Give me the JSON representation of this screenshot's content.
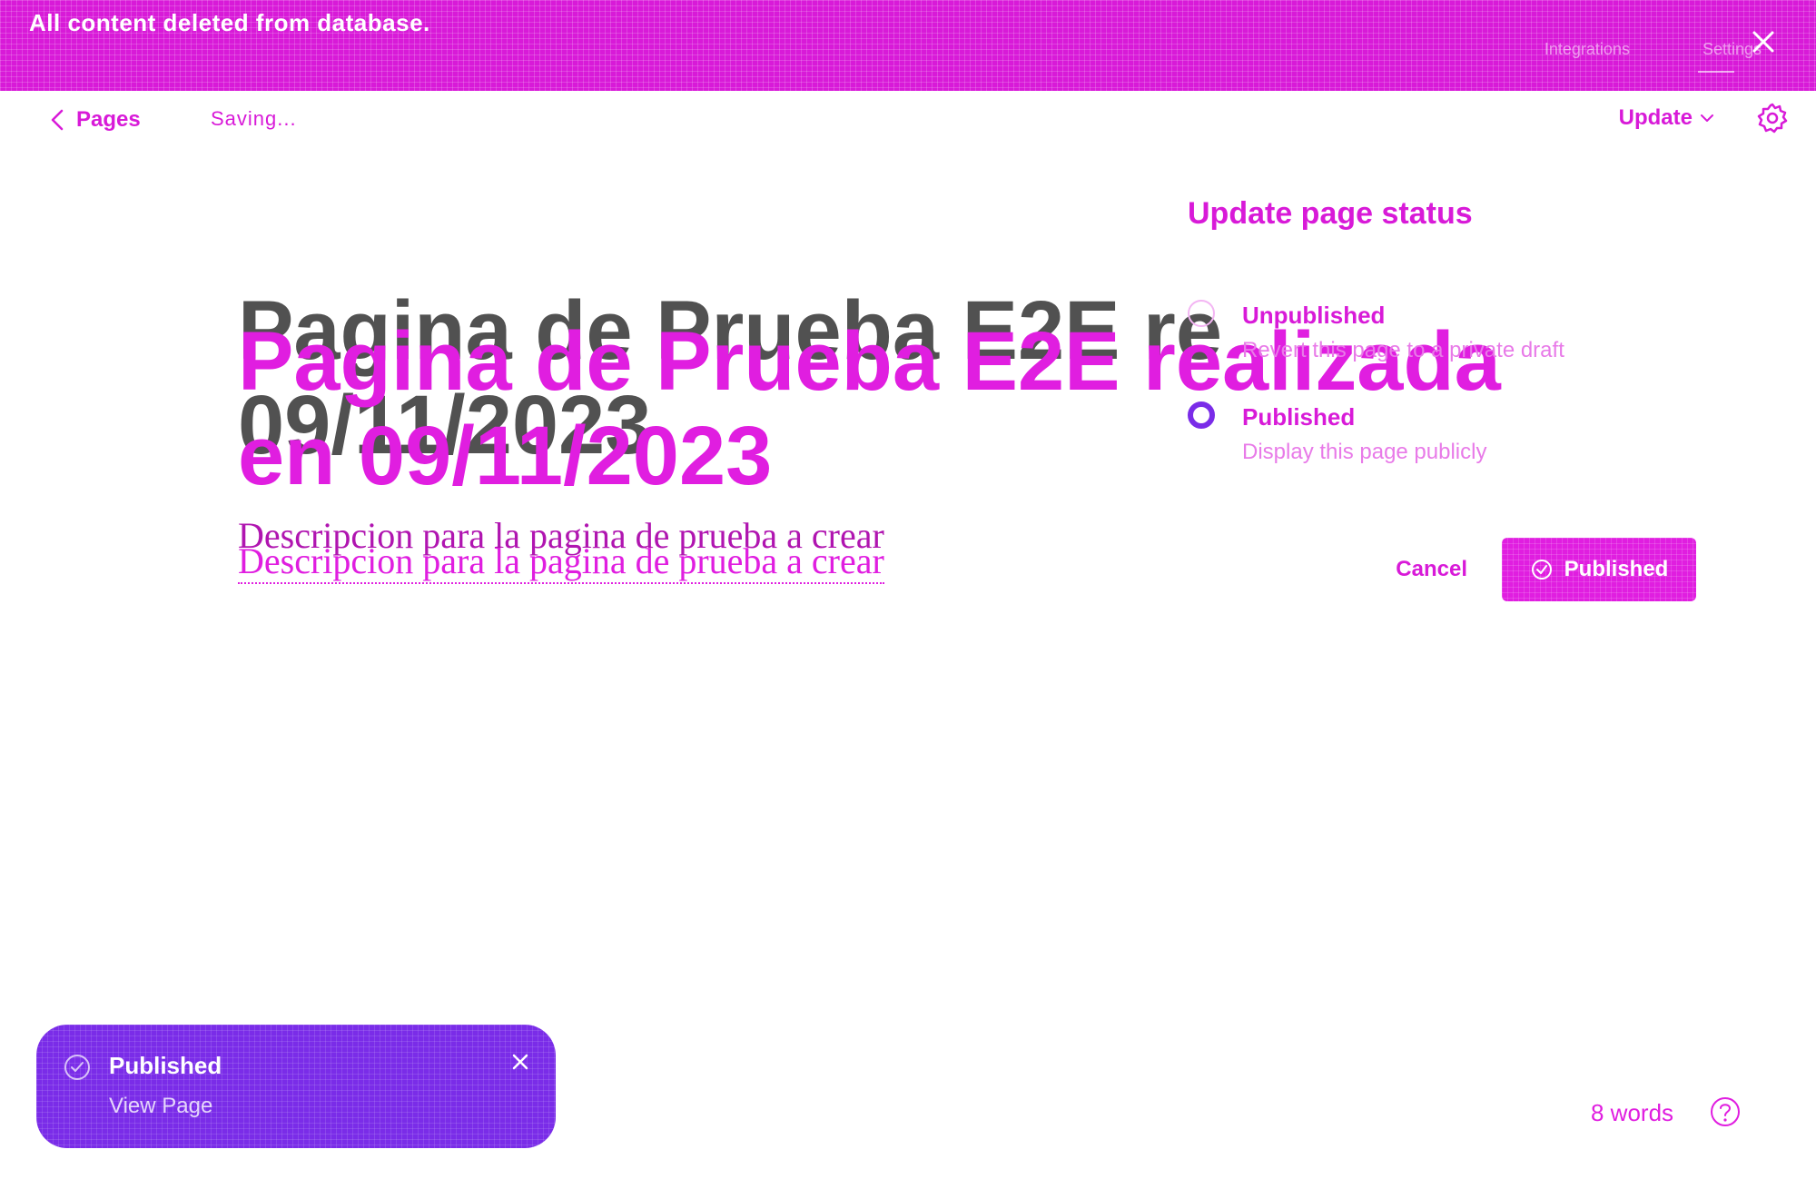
{
  "banner": {
    "message": "All content deleted from database.",
    "right_text_1": "Integrations",
    "right_text_2": "Settings"
  },
  "toolbar": {
    "back_label": "Pages",
    "saving_label": "Saving...",
    "update_label": "Update"
  },
  "editor": {
    "title": "Pagina de Prueba E2E realizada en 09/11/2023",
    "title_shadow_line1": "Pagina de Prueba E2E re",
    "title_shadow_line2": "09/11/2023",
    "description": "Descripcion para la pagina de prueba a crear"
  },
  "status_panel": {
    "title": "Update page status",
    "options": [
      {
        "label": "Unpublished",
        "description": "Revert this page to a private draft",
        "selected": false
      },
      {
        "label": "Published",
        "description": "Display this page publicly",
        "selected": true
      }
    ],
    "cancel_label": "Cancel",
    "confirm_label": "Published"
  },
  "toast": {
    "title": "Published",
    "link": "View Page"
  },
  "footer": {
    "word_count": "8 words"
  },
  "colors": {
    "accent": "#d81ad8",
    "accent_light": "#e01ee0",
    "purple": "#7a2ce8"
  }
}
